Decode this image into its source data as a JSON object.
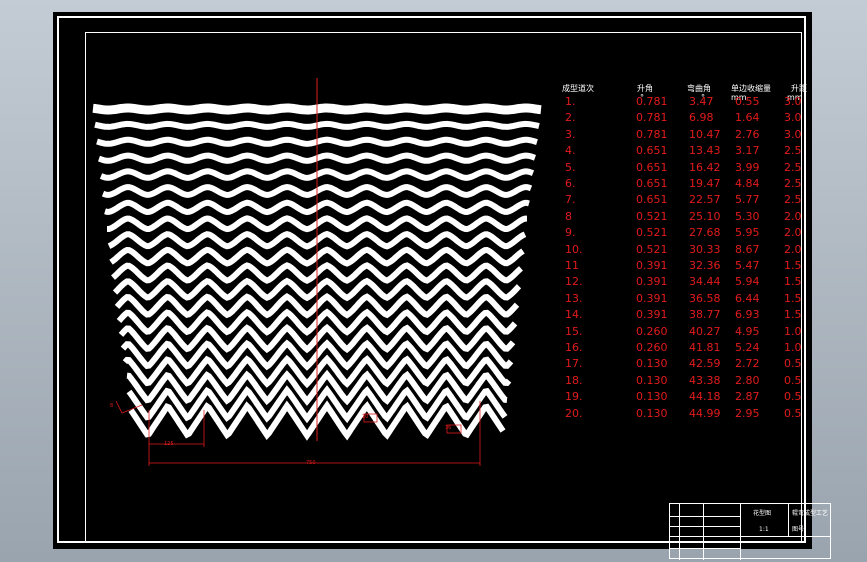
{
  "colors": {
    "background": "#000000",
    "frame": "#ffffff",
    "annotation": "#e21b1b",
    "window": "#b4bcc6"
  },
  "table": {
    "headers": [
      "成型道次",
      "升角",
      "弯曲角",
      "单边收缩量",
      "升距"
    ],
    "units": [
      "°",
      "°",
      "mm",
      "mm"
    ],
    "rows": [
      [
        "1.",
        "0.781",
        "3.47",
        "0.55",
        "3.0"
      ],
      [
        "2.",
        "0.781",
        "6.98",
        "1.64",
        "3.0"
      ],
      [
        "3.",
        "0.781",
        "10.47",
        "2.76",
        "3.0"
      ],
      [
        "4.",
        "0.651",
        "13.43",
        "3.17",
        "2.5"
      ],
      [
        "5.",
        "0.651",
        "16.42",
        "3.99",
        "2.5"
      ],
      [
        "6.",
        "0.651",
        "19.47",
        "4.84",
        "2.5"
      ],
      [
        "7.",
        "0.651",
        "22.57",
        "5.77",
        "2.5"
      ],
      [
        "8",
        "0.521",
        "25.10",
        "5.30",
        "2.0"
      ],
      [
        "9.",
        "0.521",
        "27.68",
        "5.95",
        "2.0"
      ],
      [
        "10.",
        "0.521",
        "30.33",
        "8.67",
        "2.0"
      ],
      [
        "11",
        "0.391",
        "32.36",
        "5.47",
        "1.5"
      ],
      [
        "12.",
        "0.391",
        "34.44",
        "5.94",
        "1.5"
      ],
      [
        "13.",
        "0.391",
        "36.58",
        "6.44",
        "1.5"
      ],
      [
        "14.",
        "0.391",
        "38.77",
        "6.93",
        "1.5"
      ],
      [
        "15.",
        "0.260",
        "40.27",
        "4.95",
        "1.0"
      ],
      [
        "16.",
        "0.260",
        "41.81",
        "5.24",
        "1.0"
      ],
      [
        "17.",
        "0.130",
        "42.59",
        "2.72",
        "0.5"
      ],
      [
        "18.",
        "0.130",
        "43.38",
        "2.80",
        "0.5"
      ],
      [
        "19.",
        "0.130",
        "44.18",
        "2.87",
        "0.5"
      ],
      [
        "20.",
        "0.130",
        "44.99",
        "2.95",
        "0.5"
      ]
    ]
  },
  "dimensions": {
    "pitch": "125",
    "span": "750",
    "left": "8",
    "mid": "20",
    "right": "36"
  },
  "title_block": {
    "drawing_name": "花型图",
    "company": "辊弯成型工艺",
    "scale": "1:1",
    "sheet": "图号"
  }
}
